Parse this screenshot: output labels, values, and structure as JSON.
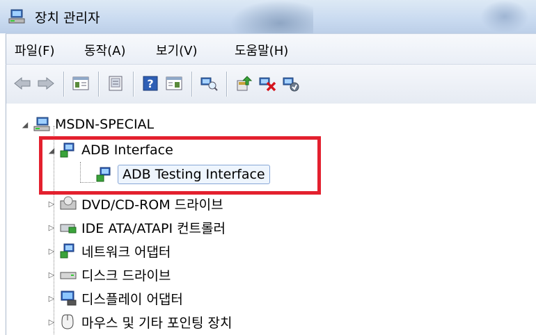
{
  "window": {
    "title": "장치 관리자",
    "title_icon": "device-manager-icon"
  },
  "menu": [
    {
      "label": "파일(F)"
    },
    {
      "label": "동작(A)"
    },
    {
      "label": "보기(V)"
    },
    {
      "label": "도움말(H)"
    }
  ],
  "toolbar": [
    {
      "icon": "back-arrow-icon"
    },
    {
      "icon": "forward-arrow-icon"
    },
    {
      "icon": "properties-view-icon"
    },
    {
      "icon": "show-hide-console-tree-icon"
    },
    {
      "icon": "help-icon"
    },
    {
      "icon": "view-pane-icon"
    },
    {
      "icon": "scan-hardware-icon"
    },
    {
      "icon": "update-driver-icon"
    },
    {
      "icon": "uninstall-icon"
    },
    {
      "icon": "disable-device-icon"
    }
  ],
  "tree": {
    "root": "MSDN-SPECIAL",
    "adb_group": "ADB Interface",
    "adb_child": "ADB Testing Interface",
    "dvd": "DVD/CD-ROM 드라이브",
    "ide": "IDE ATA/ATAPI 컨트롤러",
    "network": "네트워크 어댑터",
    "disk": "디스크 드라이브",
    "display": "디스플레이 어댑터",
    "mouse": "마우스 및 기타 포인팅 장치"
  },
  "colors": {
    "highlight_box": "#e3202e",
    "selection_border": "#87a6d6"
  }
}
